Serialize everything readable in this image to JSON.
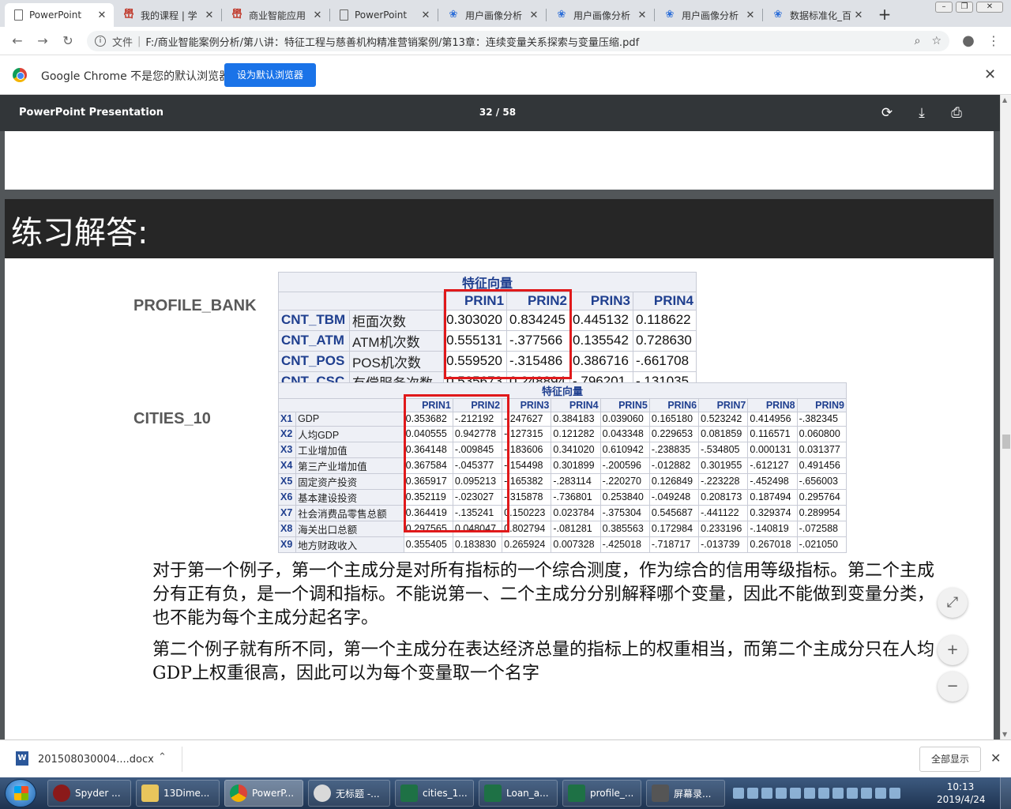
{
  "browser": {
    "tabs": [
      {
        "title": "PowerPoint",
        "favicon": "document-icon",
        "active": true
      },
      {
        "title": "我的课程 | 学",
        "favicon": "brand-red-icon"
      },
      {
        "title": "商业智能应用",
        "favicon": "brand-red-icon"
      },
      {
        "title": "PowerPoint",
        "favicon": "document-icon"
      },
      {
        "title": "用户画像分析",
        "favicon": "paw-icon"
      },
      {
        "title": "用户画像分析",
        "favicon": "paw-icon"
      },
      {
        "title": "用户画像分析",
        "favicon": "paw-icon"
      },
      {
        "title": "数据标准化_百",
        "favicon": "paw-icon"
      }
    ],
    "address": {
      "scheme_label": "文件",
      "url": "F:/商业智能案例分析/第八讲：特征工程与慈善机构精准营销案例/第13章：连续变量关系探索与变量压缩.pdf"
    },
    "infobar": {
      "message": "Google Chrome 不是您的默认浏览器",
      "button": "设为默认浏览器"
    }
  },
  "pdf": {
    "title": "PowerPoint Presentation",
    "page_indicator": "32 / 58"
  },
  "slide": {
    "heading": "练习解答:",
    "profile_bank": {
      "label": "PROFILE_BANK",
      "caption": "特征向量",
      "headers": [
        "PRIN1",
        "PRIN2",
        "PRIN3",
        "PRIN4"
      ],
      "rows": [
        {
          "code": "CNT_TBM",
          "name": "柜面次数",
          "values": [
            "0.303020",
            "0.834245",
            "0.445132",
            "0.118622"
          ]
        },
        {
          "code": "CNT_ATM",
          "name": "ATM机次数",
          "values": [
            "0.555131",
            "-.377566",
            "0.135542",
            "0.728630"
          ]
        },
        {
          "code": "CNT_POS",
          "name": "POS机次数",
          "values": [
            "0.559520",
            "-.315486",
            "0.386716",
            "-.661708"
          ]
        },
        {
          "code": "CNT_CSC",
          "name": "有偿服务次数",
          "values": [
            "0.535673",
            "0.248894",
            "-.796201",
            "-.131035"
          ]
        }
      ]
    },
    "cities": {
      "label": "CITIES_10",
      "caption": "特征向量",
      "headers": [
        "PRIN1",
        "PRIN2",
        "PRIN3",
        "PRIN4",
        "PRIN5",
        "PRIN6",
        "PRIN7",
        "PRIN8",
        "PRIN9"
      ],
      "rows": [
        {
          "code": "X1",
          "name": "GDP",
          "values": [
            "0.353682",
            "-.212192",
            "-.247627",
            "0.384183",
            "0.039060",
            "0.165180",
            "0.523242",
            "0.414956",
            "-.382345"
          ]
        },
        {
          "code": "X2",
          "name": "人均GDP",
          "values": [
            "0.040555",
            "0.942778",
            "-.127315",
            "0.121282",
            "0.043348",
            "0.229653",
            "0.081859",
            "0.116571",
            "0.060800"
          ]
        },
        {
          "code": "X3",
          "name": "工业增加值",
          "values": [
            "0.364148",
            "-.009845",
            "-.183606",
            "0.341020",
            "0.610942",
            "-.238835",
            "-.534805",
            "0.000131",
            "0.031377"
          ]
        },
        {
          "code": "X4",
          "name": "第三产业增加值",
          "values": [
            "0.367584",
            "-.045377",
            "-.154498",
            "0.301899",
            "-.200596",
            "-.012882",
            "0.301955",
            "-.612127",
            "0.491456"
          ]
        },
        {
          "code": "X5",
          "name": "固定资产投资",
          "values": [
            "0.365917",
            "0.095213",
            "-.165382",
            "-.283114",
            "-.220270",
            "0.126849",
            "-.223228",
            "-.452498",
            "-.656003"
          ]
        },
        {
          "code": "X6",
          "name": "基本建设投资",
          "values": [
            "0.352119",
            "-.023027",
            "-.315878",
            "-.736801",
            "0.253840",
            "-.049248",
            "0.208173",
            "0.187494",
            "0.295764"
          ]
        },
        {
          "code": "X7",
          "name": "社会消费品零售总额",
          "values": [
            "0.364419",
            "-.135241",
            "0.150223",
            "0.023784",
            "-.375304",
            "0.545687",
            "-.441122",
            "0.329374",
            "0.289954"
          ]
        },
        {
          "code": "X8",
          "name": "海关出口总额",
          "values": [
            "0.297565",
            "0.048047",
            "0.802794",
            "-.081281",
            "0.385563",
            "0.172984",
            "0.233196",
            "-.140819",
            "-.072588"
          ]
        },
        {
          "code": "X9",
          "name": "地方财政收入",
          "values": [
            "0.355405",
            "0.183830",
            "0.265924",
            "0.007328",
            "-.425018",
            "-.718717",
            "-.013739",
            "0.267018",
            "-.021050"
          ]
        }
      ]
    },
    "paragraph1": "对于第一个例子，第一个主成分是对所有指标的一个综合测度，作为综合的信用等级指标。第二个主成分有正有负，是一个调和指标。不能说第一、二个主成分分别解释哪个变量，因此不能做到变量分类，也不能为每个主成分起名字。",
    "paragraph2": "第二个例子就有所不同，第一个主成分在表达经济总量的指标上的权重相当，而第二个主成分只在人均GDP上权重很高，因此可以为每个变量取一个名字"
  },
  "downloads": {
    "file": "201508030004....docx",
    "show_all": "全部显示"
  },
  "taskbar": {
    "items": [
      {
        "label": "Spyder ...",
        "icon": "spyder-icon"
      },
      {
        "label": "13Dime...",
        "icon": "folder-icon"
      },
      {
        "label": "PowerP...",
        "icon": "chrome-icon",
        "active": true
      },
      {
        "label": "无标题 -...",
        "icon": "paint-icon"
      },
      {
        "label": "cities_1...",
        "icon": "excel-icon"
      },
      {
        "label": "Loan_a...",
        "icon": "excel-icon"
      },
      {
        "label": "profile_...",
        "icon": "excel-icon"
      },
      {
        "label": "屏幕录...",
        "icon": "recorder-icon"
      }
    ],
    "time": "10:13",
    "date": "2019/4/24"
  }
}
